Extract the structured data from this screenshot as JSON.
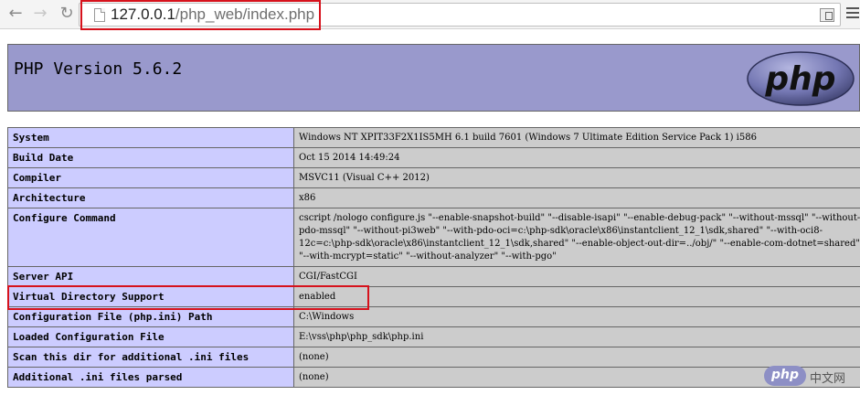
{
  "browser": {
    "url_host": "127.0.0.1",
    "url_path": "/php_web/index.php"
  },
  "header": {
    "title": "PHP Version 5.6.2",
    "logo_text": "php"
  },
  "rows": [
    {
      "key": "System",
      "value": "Windows NT XPIT33F2X1IS5MH 6.1 build 7601 (Windows 7 Ultimate Edition Service Pack 1) i586"
    },
    {
      "key": "Build Date",
      "value": "Oct 15 2014 14:49:24"
    },
    {
      "key": "Compiler",
      "value": "MSVC11 (Visual C++ 2012)"
    },
    {
      "key": "Architecture",
      "value": "x86"
    },
    {
      "key": "Configure Command",
      "value": "cscript /nologo configure.js \"--enable-snapshot-build\" \"--disable-isapi\" \"--enable-debug-pack\" \"--without-mssql\" \"--without-pdo-mssql\" \"--without-pi3web\" \"--with-pdo-oci=c:\\php-sdk\\oracle\\x86\\instantclient_12_1\\sdk,shared\" \"--with-oci8-12c=c:\\php-sdk\\oracle\\x86\\instantclient_12_1\\sdk,shared\" \"--enable-object-out-dir=../obj/\" \"--enable-com-dotnet=shared\" \"--with-mcrypt=static\" \"--without-analyzer\" \"--with-pgo\""
    },
    {
      "key": "Server API",
      "value": "CGI/FastCGI"
    },
    {
      "key": "Virtual Directory Support",
      "value": "enabled"
    },
    {
      "key": "Configuration File (php.ini) Path",
      "value": "C:\\Windows"
    },
    {
      "key": "Loaded Configuration File",
      "value": "E:\\vss\\php\\php_sdk\\php.ini"
    },
    {
      "key": "Scan this dir for additional .ini files",
      "value": "(none)"
    },
    {
      "key": "Additional .ini files parsed",
      "value": "(none)"
    }
  ],
  "watermark": {
    "badge": "php",
    "text": "中文网"
  }
}
